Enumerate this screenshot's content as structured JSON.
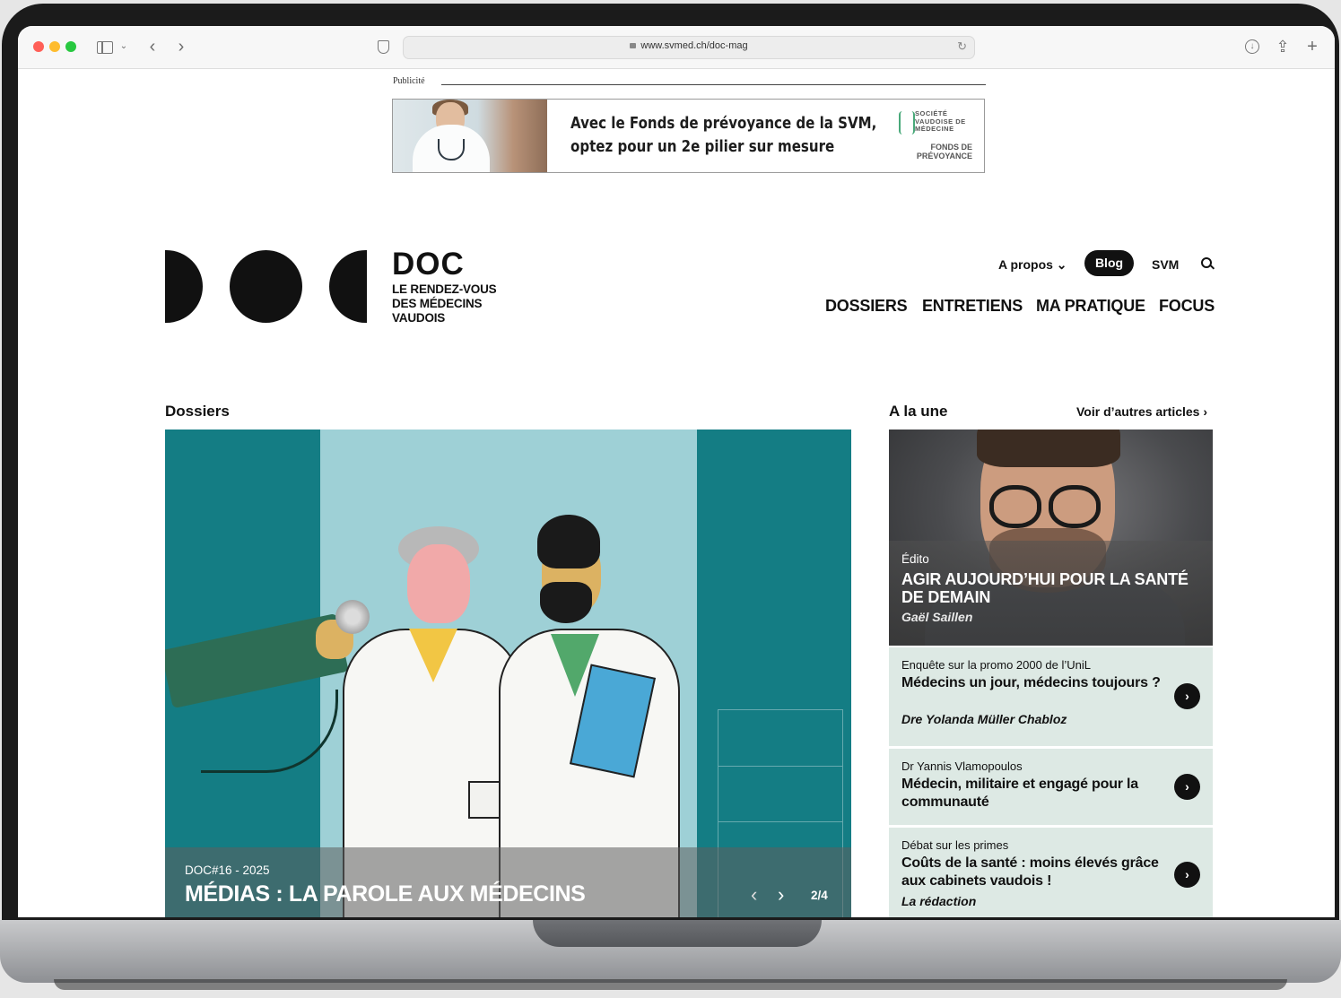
{
  "browser": {
    "url": "www.svmed.ch/doc-mag",
    "back_icon": "‹",
    "forward_icon": "›",
    "reload_icon": "↻",
    "share_icon": "⇪",
    "new_tab_icon": "+"
  },
  "ad": {
    "label": "Publicité",
    "text_line1": "Avec le Fonds de prévoyance de la SVM,",
    "text_line2": "optez pour un 2e pilier sur mesure",
    "logo_top": "SOCIÉTÉ\nVAUDOISE DE\nMÉDECINE",
    "logo_bottom": "FONDS DE\nPRÉVOYANCE"
  },
  "site": {
    "brand": "DOC",
    "tagline": "LE RENDEZ-VOUS DES MÉDECINS VAUDOIS"
  },
  "nav": {
    "apropos": "A propos ⌄",
    "blog": "Blog",
    "svm": "SVM",
    "main": [
      "DOSSIERS",
      "ENTRETIENS",
      "MA PRATIQUE",
      "FOCUS"
    ]
  },
  "dossiers": {
    "section_title": "Dossiers",
    "kicker": "DOC#16 - 2025",
    "title": "MÉDIAS : LA PAROLE AUX MÉDECINS",
    "prev": "‹",
    "next": "›",
    "counter": "2/4"
  },
  "une": {
    "section_title": "A la une",
    "more_link": "Voir d’autres articles  ›",
    "featured": {
      "kicker": "Édito",
      "title": "AGIR AUJOURD’HUI POUR LA SANTÉ DE DEMAIN",
      "author": "Gaël Saillen"
    },
    "articles": [
      {
        "kicker": "Enquête sur la promo 2000 de l’UniL",
        "title": "Médecins un jour, médecins toujours ?",
        "author": "Dre Yolanda Müller Chabloz"
      },
      {
        "kicker": "Dr Yannis Vlamopoulos",
        "title": "Médecin, militaire et engagé pour la communauté",
        "author": ""
      },
      {
        "kicker": "Débat sur les primes",
        "title": "Coûts de la santé : moins élevés grâce aux cabinets vaudois !",
        "author": "La rédaction"
      }
    ],
    "arrow": "›"
  }
}
